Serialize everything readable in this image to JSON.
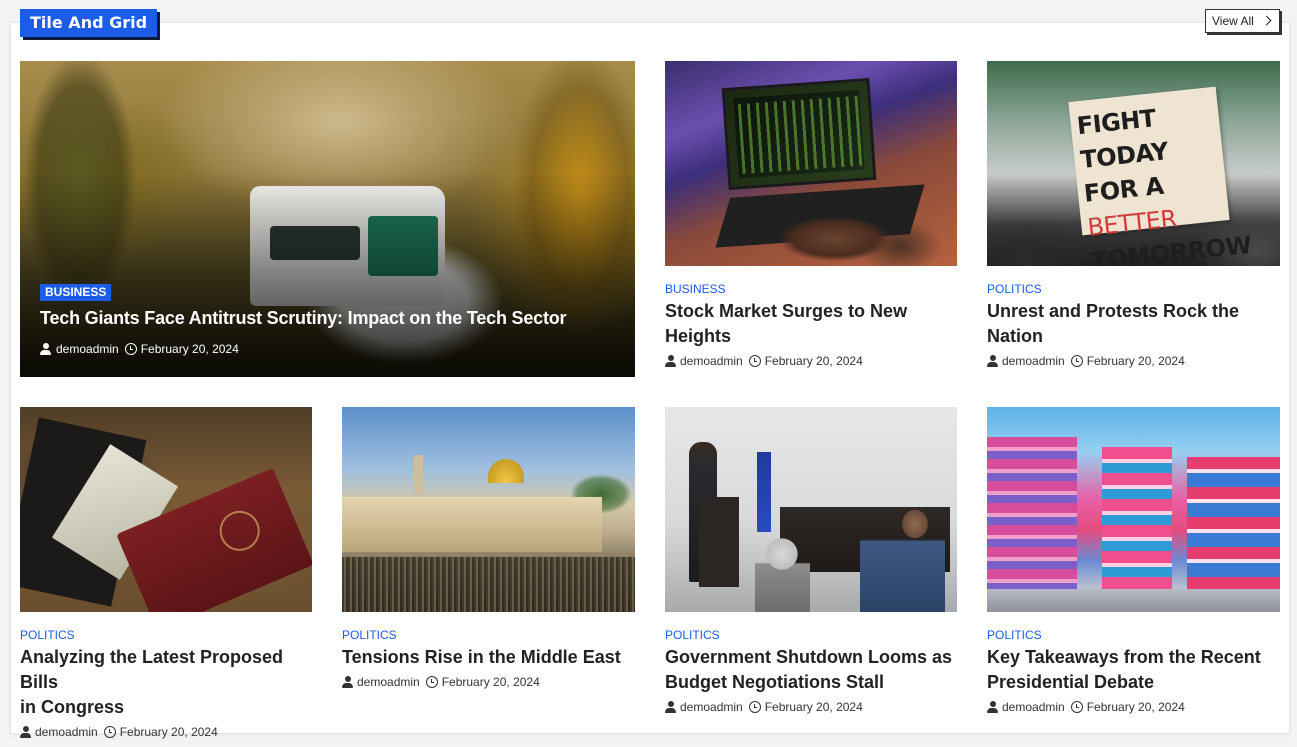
{
  "section": {
    "title": "Tile And Grid",
    "view_all_label": "View All"
  },
  "featured": {
    "category": "BUSINESS",
    "title": "Tech Giants Face Antitrust Scrutiny: Impact on the Tech Sector",
    "author": "demoadmin",
    "date": "February 20, 2024"
  },
  "cards": [
    {
      "category": "BUSINESS",
      "title_lines": [
        "Stock Market Surges to New",
        "Heights"
      ],
      "author": "demoadmin",
      "date": "February 20, 2024"
    },
    {
      "category": "POLITICS",
      "title_lines": [
        "Unrest and Protests Rock the",
        "Nation"
      ],
      "author": "demoadmin",
      "date": "February 20, 2024",
      "image_sign_text": [
        "FIGHT TODAY",
        "FOR A",
        "BETTER",
        "TOMORROW"
      ]
    },
    {
      "category": "POLITICS",
      "title_lines": [
        "Analyzing the Latest Proposed Bills",
        "in Congress"
      ],
      "author": "demoadmin",
      "date": "February 20, 2024"
    },
    {
      "category": "POLITICS",
      "title_lines": [
        "Tensions Rise in the Middle East"
      ],
      "author": "demoadmin",
      "date": "February 20, 2024"
    },
    {
      "category": "POLITICS",
      "title_lines": [
        "Government Shutdown Looms as",
        "Budget Negotiations Stall"
      ],
      "author": "demoadmin",
      "date": "February 20, 2024"
    },
    {
      "category": "POLITICS",
      "title_lines": [
        "Key Takeaways from the Recent",
        "Presidential Debate"
      ],
      "author": "demoadmin",
      "date": "February 20, 2024"
    }
  ],
  "icons": {
    "author": "user-icon",
    "date": "clock-icon",
    "view_all": "chevron-right-icon"
  },
  "colors": {
    "accent": "#1b5ce8",
    "title_shadow": "#0d1b3a",
    "text": "#222222",
    "page_bg": "#f1f3f4"
  }
}
